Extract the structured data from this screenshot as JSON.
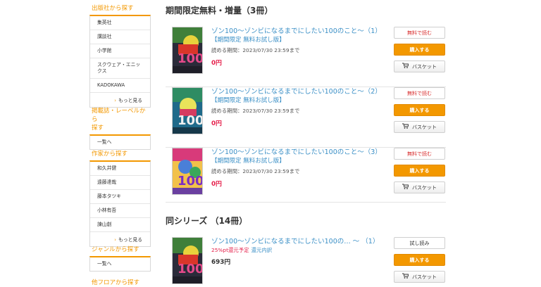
{
  "sidebar": {
    "publisher": {
      "heading": "出版社から探す",
      "items": [
        "集英社",
        "講談社",
        "小学館",
        "スクウェア・エニックス",
        "KADOKAWA"
      ],
      "more": "もっと見る"
    },
    "magazine": {
      "heading_line1": "掲載誌・レーベルから",
      "heading_line2": "探す",
      "items": [
        "一覧へ"
      ]
    },
    "author": {
      "heading": "作家から探す",
      "items": [
        "和久井健",
        "遠藤達哉",
        "藤本タツキ",
        "小林有吾",
        "諫山創"
      ],
      "more": "もっと見る"
    },
    "genre": {
      "heading": "ジャンルから探す",
      "items": [
        "一覧へ"
      ]
    },
    "floor": {
      "heading": "他フロアから探す"
    }
  },
  "main": {
    "limited_title": "期間限定無料・増量（3冊）",
    "series_title": "同シリーズ （14冊）",
    "limited_items": [
      {
        "title": "ゾン100～ゾンビになるまでにしたい100のこと～（1）",
        "subtitle": "【期間限定 無料お試し版】",
        "period": "読める期間：2023/07/30 23:59まで",
        "price": "0円",
        "btn_free": "無料で読む",
        "btn_buy": "購入する",
        "btn_cart": "バスケット"
      },
      {
        "title": "ゾン100～ゾンビになるまでにしたい100のこと～（2）",
        "subtitle": "【期間限定 無料お試し版】",
        "period": "読める期間：2023/07/30 23:59まで",
        "price": "0円",
        "btn_free": "無料で読む",
        "btn_buy": "購入する",
        "btn_cart": "バスケット"
      },
      {
        "title": "ゾン100～ゾンビになるまでにしたい100のこと～（3）",
        "subtitle": "【期間限定 無料お試し版】",
        "period": "読める期間：2023/07/30 23:59まで",
        "price": "0円",
        "btn_free": "無料で読む",
        "btn_buy": "購入する",
        "btn_cart": "バスケット"
      }
    ],
    "series_items": [
      {
        "title": "ゾン100～ゾンビになるまでにしたい100の… ～ （1）",
        "points": "25%pt還元予定",
        "points_link": "還元内訳",
        "price": "693円",
        "btn_trial": "試し読み",
        "btn_buy": "購入する",
        "btn_cart": "バスケット"
      }
    ]
  },
  "colors": {
    "accent": "#f39800",
    "link": "#3a8fc6",
    "price_red": "#e5204b"
  }
}
